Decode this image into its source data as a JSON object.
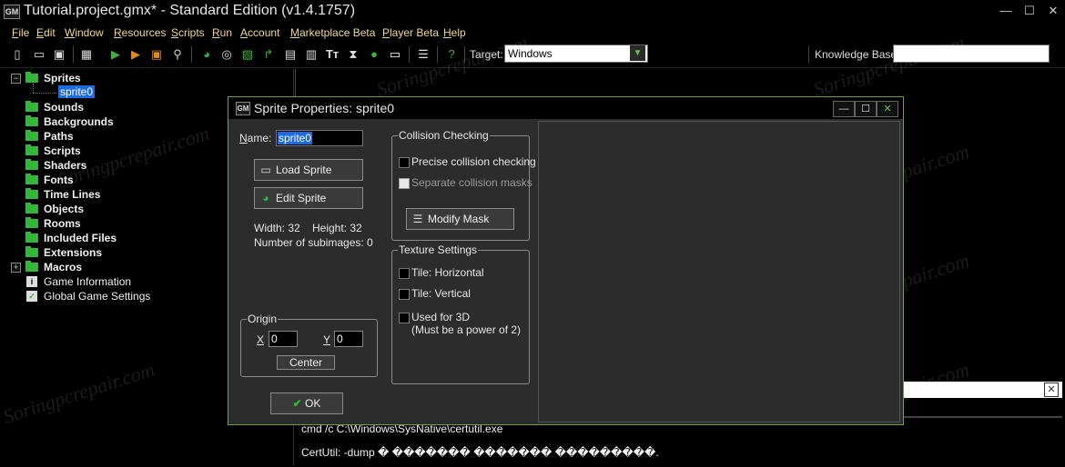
{
  "window": {
    "title": "Tutorial.project.gmx*  -  Standard Edition (v1.4.1757)",
    "icon_text": "GM",
    "controls": {
      "minimize": "—",
      "maximize": "☐",
      "close": "✕"
    }
  },
  "menu": [
    "File",
    "Edit",
    "Window",
    "Resources",
    "Scripts",
    "Run",
    "Account",
    "Marketplace Beta",
    "Player Beta",
    "Help"
  ],
  "toolbar": {
    "target_label": "Target:",
    "target_value": "Windows",
    "knowledge_label": "Knowledge Base:",
    "knowledge_value": ""
  },
  "tree": {
    "items": [
      {
        "label": "Sprites",
        "expanded": true
      },
      {
        "label": "sprite0",
        "selected": true
      },
      {
        "label": "Sounds"
      },
      {
        "label": "Backgrounds"
      },
      {
        "label": "Paths"
      },
      {
        "label": "Scripts"
      },
      {
        "label": "Shaders"
      },
      {
        "label": "Fonts"
      },
      {
        "label": "Time Lines"
      },
      {
        "label": "Objects"
      },
      {
        "label": "Rooms"
      },
      {
        "label": "Included Files"
      },
      {
        "label": "Extensions"
      },
      {
        "label": "Macros",
        "expandable": true
      },
      {
        "label": "Game Information",
        "icon": "info-icon"
      },
      {
        "label": "Global Game Settings",
        "icon": "settings-icon"
      }
    ],
    "expand_glyph": "−",
    "collapse_glyph": "+"
  },
  "output": {
    "line1": "cmd /c    C:\\Windows\\SysNative\\certutil.exe",
    "line2": "CertUtil: -dump � ������� ������� ���������.",
    "close_glyph": "✕"
  },
  "dialog": {
    "title": "Sprite Properties: sprite0",
    "name_label": "Name:",
    "name_value": "sprite0",
    "load_sprite": "Load Sprite",
    "edit_sprite": "Edit Sprite",
    "width_text": "Width: 32",
    "height_text": "Height: 32",
    "subimages_text": "Number of subimages: 0",
    "origin": {
      "title": "Origin",
      "x_label": "X",
      "x_value": "0",
      "y_label": "Y",
      "y_value": "0",
      "center_button": "Center"
    },
    "ok_button": "OK",
    "collision": {
      "title": "Collision Checking",
      "precise": {
        "label": "Precise collision checking",
        "checked": false
      },
      "separate": {
        "label": "Separate collision masks",
        "checked": false,
        "disabled": true
      },
      "modify_mask": "Modify Mask"
    },
    "texture": {
      "title": "Texture Settings",
      "tile_h": {
        "label": "Tile: Horizontal",
        "checked": false
      },
      "tile_v": {
        "label": "Tile: Vertical",
        "checked": false
      },
      "used_3d": {
        "label": "Used for 3D",
        "note": "(Must be a power of 2)",
        "checked": false
      }
    }
  },
  "watermark": "Soringpcrepair.com",
  "colors": {
    "accent_green": "#35b53a",
    "menu_text": "#f0d98c",
    "selection": "#1e6ae0",
    "dialog_bg": "#2c2c2c",
    "dialog_border": "#6a9d5a"
  }
}
